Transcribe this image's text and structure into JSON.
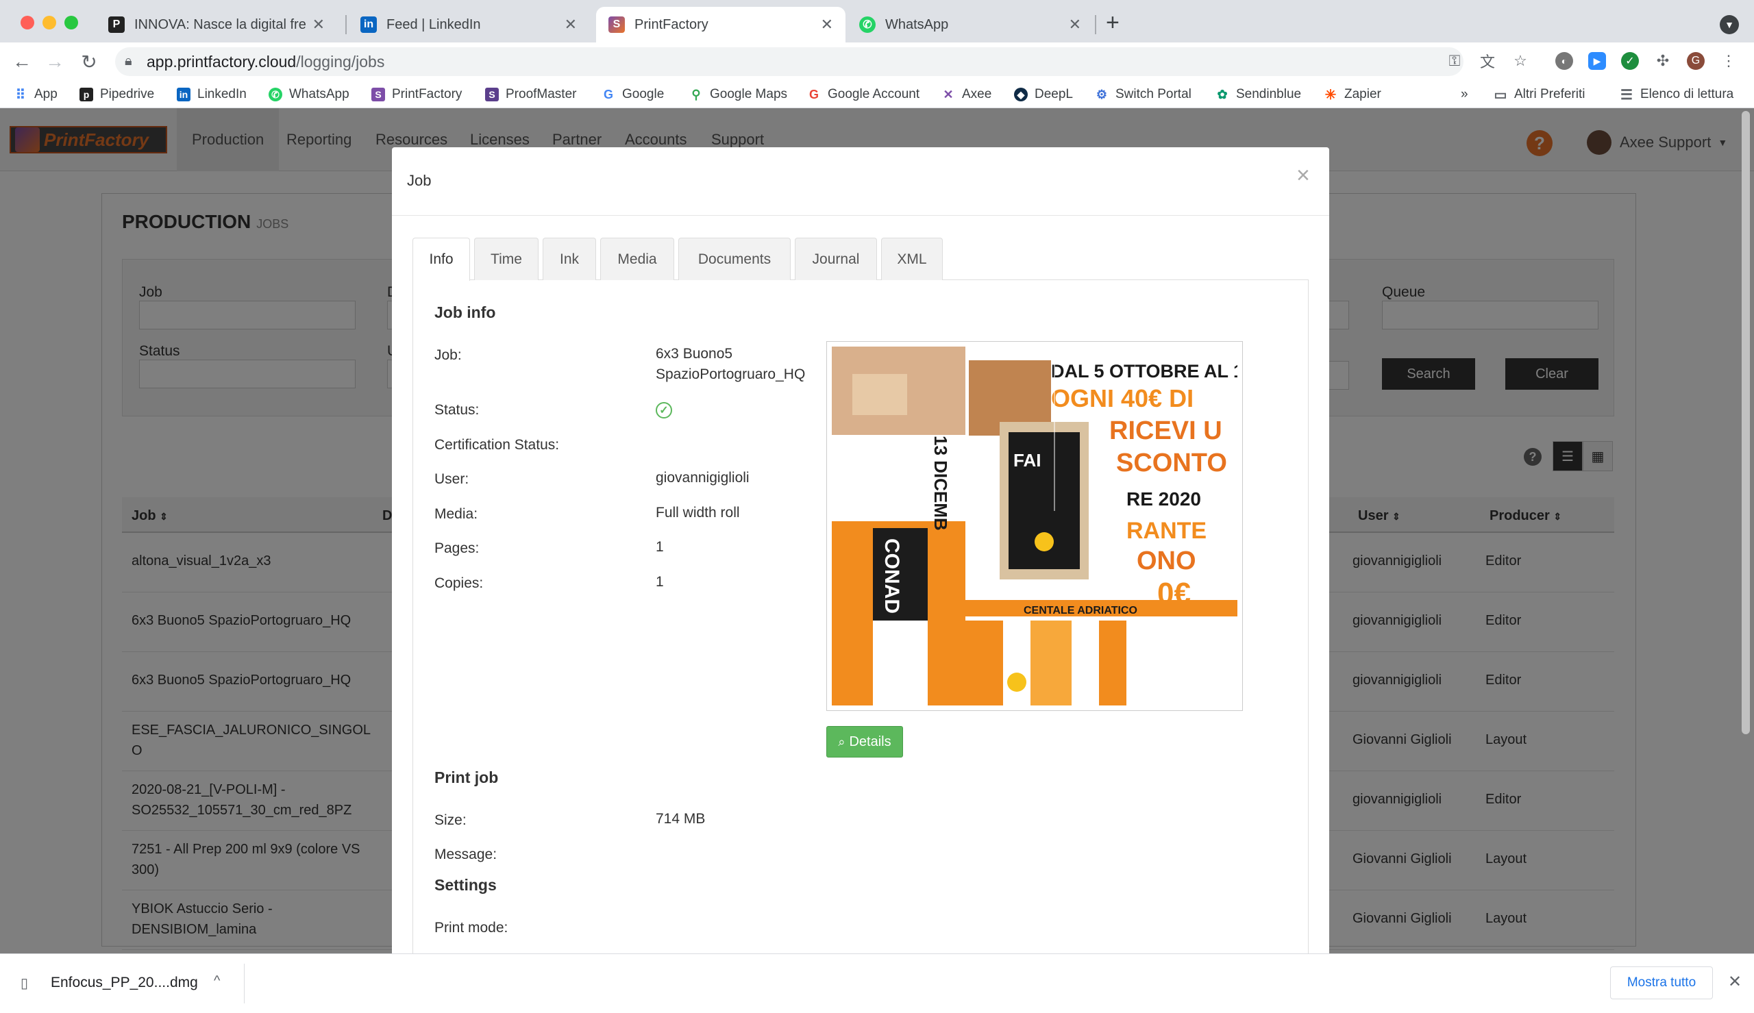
{
  "browser": {
    "tabs": [
      {
        "title": "INNOVA: Nasce la digital freedom",
        "icon": "innova-favicon",
        "color": "#222222"
      },
      {
        "title": "Feed | LinkedIn",
        "icon": "linkedin-favicon",
        "color": "#0a66c2"
      },
      {
        "title": "PrintFactory",
        "icon": "printfactory-favicon",
        "color": "#7d4ea8"
      },
      {
        "title": "WhatsApp",
        "icon": "whatsapp-favicon",
        "color": "#25d366"
      }
    ],
    "url_host": "app.printfactory.cloud",
    "url_path": "/logging/jobs",
    "profile_initial": "G",
    "bookmarks": [
      {
        "label": "App",
        "color": "#4285f4"
      },
      {
        "label": "Pipedrive",
        "color": "#222222"
      },
      {
        "label": "LinkedIn",
        "color": "#0a66c2"
      },
      {
        "label": "WhatsApp",
        "color": "#25d366"
      },
      {
        "label": "PrintFactory",
        "color": "#7d4ea8"
      },
      {
        "label": "ProofMaster",
        "color": "#5b3f8c"
      },
      {
        "label": "Google",
        "color": "#4285f4"
      },
      {
        "label": "Google Maps",
        "color": "#34a853"
      },
      {
        "label": "Google Account",
        "color": "#ea4335"
      },
      {
        "label": "Axee",
        "color": "#7d4ea8"
      },
      {
        "label": "DeepL",
        "color": "#0f2b46"
      },
      {
        "label": "Switch Portal",
        "color": "#3b6fd8"
      },
      {
        "label": "Sendinblue",
        "color": "#0b996e"
      },
      {
        "label": "Zapier",
        "color": "#ff4a00"
      }
    ],
    "bookmarks_more": "»",
    "other_bookmarks": "Altri Preferiti",
    "reading_list": "Elenco di lettura"
  },
  "app": {
    "brand": "PrintFactory",
    "nav": [
      "Production",
      "Reporting",
      "Resources",
      "Licenses",
      "Partner",
      "Accounts",
      "Support"
    ],
    "user": "Axee Support",
    "page_title": "PRODUCTION",
    "page_subtitle": "JOBS",
    "filters": {
      "job_label": "Job",
      "status_label": "Status",
      "queue_label": "Queue",
      "col2_label_top": "D",
      "col2_label_bottom": "U",
      "search": "Search",
      "clear": "Clear"
    },
    "table": {
      "headers": {
        "job": "Job",
        "desc": "D",
        "user": "User",
        "producer": "Producer"
      },
      "rows": [
        {
          "job": "altona_visual_1v2a_x3",
          "user": "giovannigiglioli",
          "producer": "Editor"
        },
        {
          "job": "6x3 Buono5 SpazioPortogruaro_HQ",
          "user": "giovannigiglioli",
          "producer": "Editor"
        },
        {
          "job": "6x3 Buono5 SpazioPortogruaro_HQ",
          "user": "giovannigiglioli",
          "producer": "Editor"
        },
        {
          "job": "ESE_FASCIA_JALURONICO_SINGOLO",
          "user": "Giovanni Giglioli",
          "producer": "Layout"
        },
        {
          "job": "2020-08-21_[V-POLI-M] - SO25532_105571_30_cm_red_8PZ",
          "user": "giovannigiglioli",
          "producer": "Editor"
        },
        {
          "job": "7251 - All Prep 200 ml 9x9 (colore VS 300)",
          "user": "Giovanni Giglioli",
          "producer": "Layout"
        },
        {
          "job": "YBIOK Astuccio Serio - DENSIBIOM_lamina",
          "user": "Giovanni Giglioli",
          "producer": "Layout"
        }
      ]
    }
  },
  "modal": {
    "title": "Job",
    "close": "×",
    "tabs": [
      "Info",
      "Time",
      "Ink",
      "Media",
      "Documents",
      "Journal",
      "XML"
    ],
    "job_info_heading": "Job info",
    "fields": {
      "job_label": "Job:",
      "job_value_line1": "6x3 Buono5",
      "job_value_line2": "SpazioPortogruaro_HQ",
      "status_label": "Status:",
      "certification_label": "Certification Status:",
      "user_label": "User:",
      "user_value": "giovannigiglioli",
      "media_label": "Media:",
      "media_value": "Full width roll",
      "pages_label": "Pages:",
      "pages_value": "1",
      "copies_label": "Copies:",
      "copies_value": "1"
    },
    "details_button": "Details",
    "print_job_heading": "Print job",
    "size_label": "Size:",
    "size_value": "714 MB",
    "message_label": "Message:",
    "settings_heading": "Settings",
    "print_mode_label": "Print mode:",
    "preview_text": {
      "l1": "DAL 5 OTTOBRE AL 1",
      "l2": "OGNI 40€ DI",
      "l3": "RICEVI U",
      "l4": "SCONTO",
      "l5": "RE 2020",
      "l6": "RANTE",
      "l7": "ONO",
      "l8": "0€",
      "l9": "CENTALE ADRIATICO",
      "l10": "FAI",
      "l11": "13 DICEMB",
      "l12": "CONAD"
    }
  },
  "download": {
    "filename": "Enfocus_PP_20....dmg",
    "show_all": "Mostra tutto"
  }
}
